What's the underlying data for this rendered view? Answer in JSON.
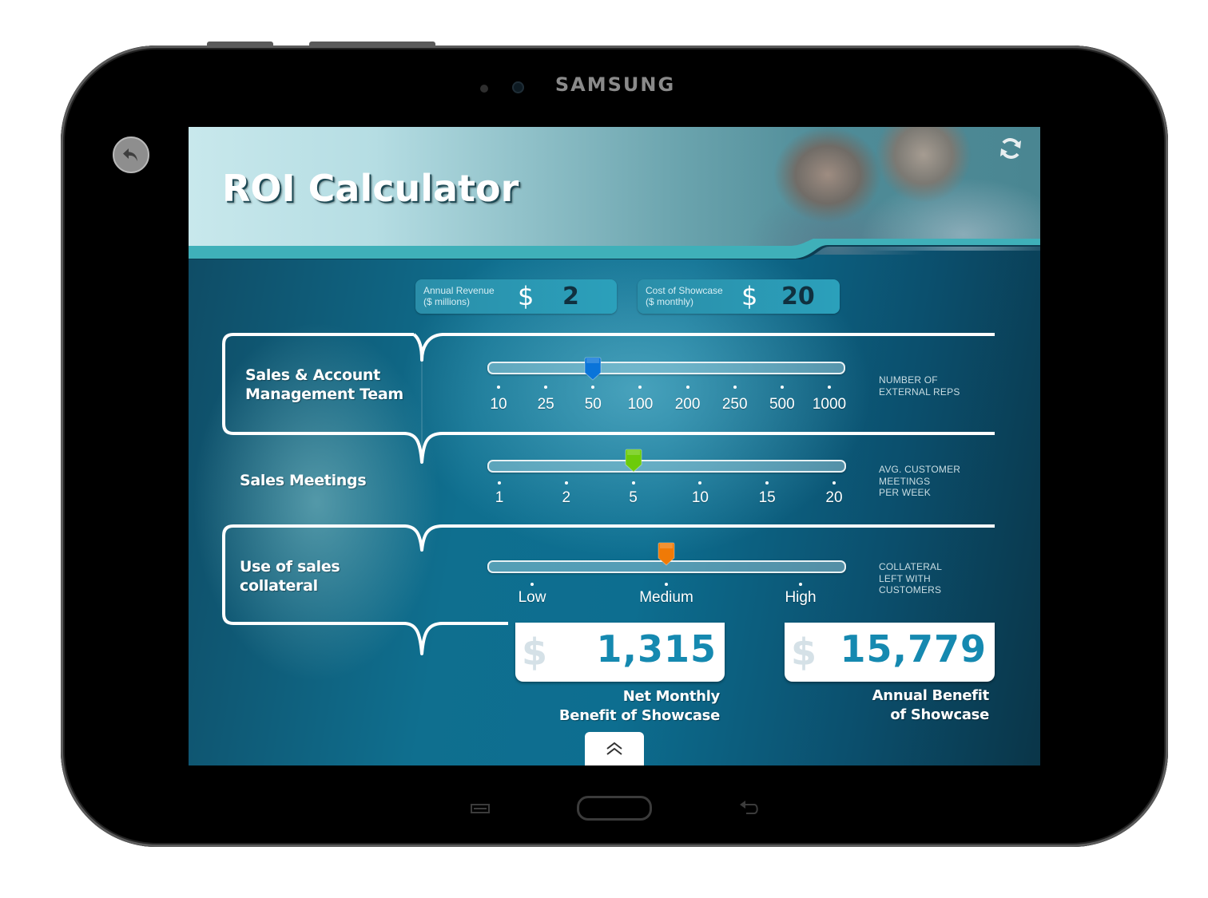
{
  "device": {
    "brand": "SAMSUNG"
  },
  "app": {
    "title": "ROI Calculator"
  },
  "inputs": {
    "annual_revenue": {
      "label_line1": "Annual Revenue",
      "label_line2": "($ millions)",
      "currency": "$",
      "value": "2"
    },
    "cost_of_showcase": {
      "label_line1": "Cost of Showcase",
      "label_line2": "($ monthly)",
      "currency": "$",
      "value": "20"
    }
  },
  "rows": [
    {
      "label_line1": "Sales & Account",
      "label_line2": "Management Team",
      "note_lines": [
        "NUMBER OF",
        "EXTERNAL REPS"
      ],
      "thumb_color": "#0a74d9",
      "ticks": [
        "10",
        "25",
        "50",
        "100",
        "200",
        "250",
        "500",
        "1000"
      ],
      "selected_index": 2,
      "selected_value": "50"
    },
    {
      "label_line1": "Sales Meetings",
      "label_line2": "",
      "note_lines": [
        "AVG. CUSTOMER",
        "MEETINGS",
        "PER WEEK"
      ],
      "thumb_color": "#6ccb0a",
      "ticks": [
        "1",
        "2",
        "5",
        "10",
        "15",
        "20"
      ],
      "selected_index": 2,
      "selected_value": "5"
    },
    {
      "label_line1": "Use of sales",
      "label_line2": "collateral",
      "note_lines": [
        "COLLATERAL",
        "LEFT WITH",
        "CUSTOMERS"
      ],
      "thumb_color": "#f07a06",
      "ticks": [
        "Low",
        "Medium",
        "High"
      ],
      "selected_index": 1,
      "selected_value": "Medium"
    }
  ],
  "results": {
    "monthly": {
      "currency": "$",
      "value": "1,315",
      "caption_line1": "Net Monthly",
      "caption_line2": "Benefit of Showcase"
    },
    "annual": {
      "currency": "$",
      "value": "15,779",
      "caption_line1": "Annual Benefit",
      "caption_line2": "of Showcase"
    }
  },
  "icons": {
    "back": "undo-arrow-icon",
    "refresh": "refresh-icon",
    "expand": "double-chevron-up-icon",
    "nav_menu": "menu-icon",
    "nav_home": "home-button",
    "nav_back": "back-icon"
  },
  "colors": {
    "accent_teal": "#3fb0b9",
    "result_value": "#1589b0",
    "background_dark": "#0b4f6d"
  }
}
